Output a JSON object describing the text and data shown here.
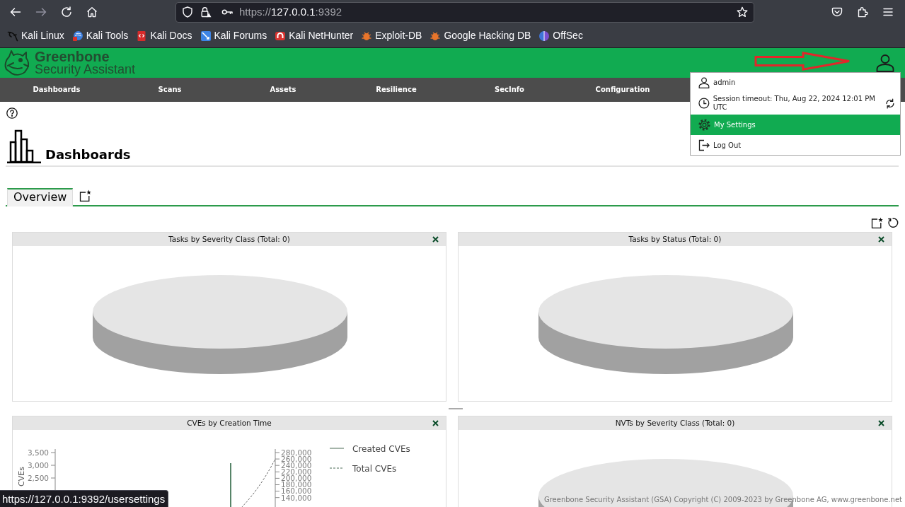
{
  "browser": {
    "address": [
      {
        "text": "https://",
        "dim": true
      },
      {
        "text": "127.0.0.1",
        "dim": false
      },
      {
        "text": ":9392",
        "dim": true
      }
    ],
    "bookmarks": [
      {
        "label": "Kali Linux"
      },
      {
        "label": "Kali Tools"
      },
      {
        "label": "Kali Docs"
      },
      {
        "label": "Kali Forums"
      },
      {
        "label": "Kali NetHunter"
      },
      {
        "label": "Exploit-DB"
      },
      {
        "label": "Google Hacking DB"
      },
      {
        "label": "OffSec"
      }
    ],
    "link_preview": "https://127.0.0.1:9392/usersettings"
  },
  "header": {
    "brand": "Greenbone",
    "tagline": "Security Assistant"
  },
  "nav": [
    {
      "label": "Dashboards"
    },
    {
      "label": "Scans"
    },
    {
      "label": "Assets"
    },
    {
      "label": "Resilience"
    },
    {
      "label": "SecInfo"
    },
    {
      "label": "Configuration"
    }
  ],
  "user_menu": [
    {
      "kind": "user",
      "label": "admin",
      "selected": false
    },
    {
      "kind": "session",
      "label": "Session timeout: Thu, Aug 22, 2024 12:01 PM UTC",
      "selected": false
    },
    {
      "kind": "settings",
      "label": "My Settings",
      "selected": true
    },
    {
      "kind": "logout",
      "label": "Log Out",
      "selected": false
    }
  ],
  "page": {
    "title": "Dashboards",
    "tabs": [
      {
        "label": "Overview",
        "selected": true
      }
    ]
  },
  "panels": [
    {
      "title": "Tasks by Severity Class (Total: 0)",
      "kind": "pie"
    },
    {
      "title": "Tasks by Status (Total: 0)",
      "kind": "pie"
    },
    {
      "title": "CVEs by Creation Time",
      "kind": "line",
      "left_axis": {
        "label": "CVEs",
        "ticks": [
          "3,500",
          "3,000",
          "2,500"
        ]
      },
      "right_axis": {
        "ticks": [
          "280,000",
          "260,000",
          "240,000",
          "220,000",
          "200,000",
          "180,000",
          "160,000",
          "140,000"
        ]
      },
      "legend": [
        {
          "label": "Created CVEs",
          "kind": "solid"
        },
        {
          "label": "Total CVEs",
          "kind": "dashed"
        }
      ]
    },
    {
      "title": "NVTs by Severity Class (Total: 0)",
      "kind": "pie"
    }
  ],
  "footer": "Greenbone Security Assistant (GSA) Copyright (C) 2009-2023 by Greenbone AG, www.greenbone.net"
}
